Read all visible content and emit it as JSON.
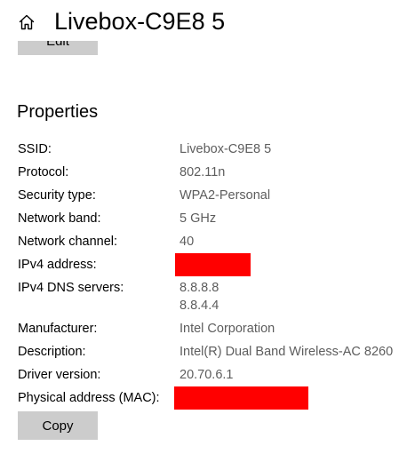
{
  "header": {
    "title": "Livebox-C9E8 5",
    "home_icon": "home-icon"
  },
  "edit_button": {
    "label": "Edit"
  },
  "properties": {
    "title": "Properties",
    "rows": [
      {
        "label": "SSID:",
        "value": "Livebox-C9E8 5"
      },
      {
        "label": "Protocol:",
        "value": "802.11n"
      },
      {
        "label": "Security type:",
        "value": "WPA2-Personal"
      },
      {
        "label": "Network band:",
        "value": "5 GHz"
      },
      {
        "label": "Network channel:",
        "value": "40"
      },
      {
        "label": "IPv4 address:",
        "value": "",
        "redacted": true,
        "redaction_color": "#ff0000"
      },
      {
        "label": "IPv4 DNS servers:",
        "values": [
          "8.8.8.8",
          "8.8.4.4"
        ]
      },
      {
        "label": "Manufacturer:",
        "value": "Intel Corporation"
      },
      {
        "label": "Description:",
        "value": "Intel(R) Dual Band Wireless-AC 8260"
      },
      {
        "label": "Driver version:",
        "value": "20.70.6.1"
      },
      {
        "label": "Physical address (MAC):",
        "value": "",
        "redacted": true,
        "redaction_color": "#ff0000"
      }
    ]
  },
  "copy_button": {
    "label": "Copy"
  },
  "colors": {
    "button_bg": "#cccccc",
    "value_text": "#5d5d5d",
    "redaction": "#ff0000"
  }
}
